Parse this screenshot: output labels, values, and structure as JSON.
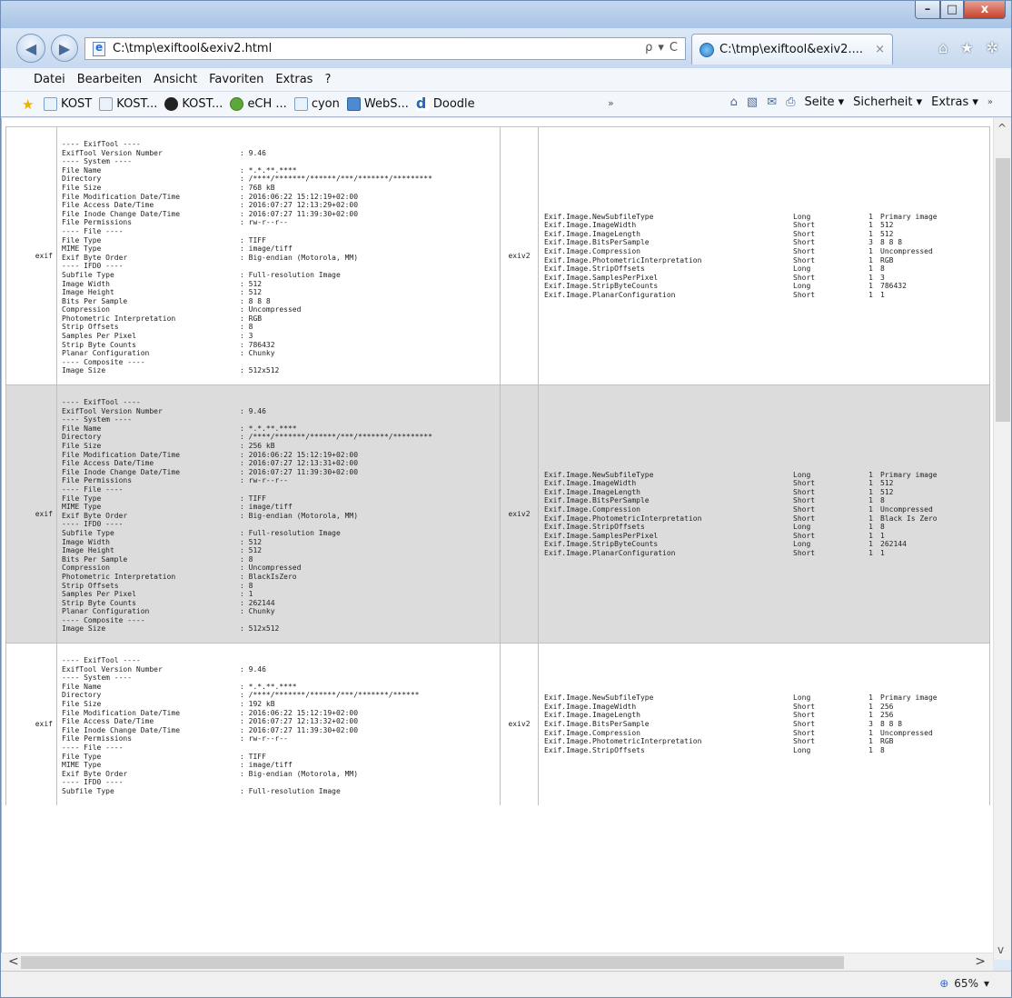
{
  "browser": {
    "address": "C:\\tmp\\exiftool&exiv2.html",
    "tab_title": "C:\\tmp\\exiftool&exiv2....",
    "tab_close": "×",
    "back_icon": "◀",
    "forward_icon": "▶",
    "search_icon": "ρ",
    "address_arrow": "▾",
    "refresh_icon": "C",
    "home_icon": "⌂",
    "favorites_icon": "★",
    "settings_icon": "✲",
    "window_minimize": "–",
    "window_maximize": "□",
    "window_close": "x"
  },
  "menu": [
    "Datei",
    "Bearbeiten",
    "Ansicht",
    "Favoriten",
    "Extras",
    "?"
  ],
  "favorites": [
    {
      "label": "KOST",
      "icon": "page-icon"
    },
    {
      "label": "KOST...",
      "icon": "page-icon"
    },
    {
      "label": "KOST...",
      "icon": "github-icon"
    },
    {
      "label": "eCH ...",
      "icon": "ech-icon"
    },
    {
      "label": "cyon",
      "icon": "page-icon"
    },
    {
      "label": "WebS...",
      "icon": "web-slice-icon"
    },
    {
      "label": "Doodle",
      "icon": "doodle-icon"
    }
  ],
  "favbar_more": "»",
  "commands": {
    "home_icon": "⌂",
    "feeds_icon": "▧",
    "mail_icon": "✉",
    "print_icon": "⎙",
    "page": "Seite ▾",
    "safety": "Sicherheit ▾",
    "tools": "Extras ▾",
    "more": "»"
  },
  "zoom": "65%",
  "zoom_icon": "⊕",
  "zoom_arrow": "▾",
  "scroll": {
    "up": "^",
    "down": "v",
    "left": "<",
    "right": ">"
  },
  "rows": [
    {
      "label1": "exif",
      "label2": "exiv2",
      "exif_lines": [
        [
          "---- ExifTool ----",
          ""
        ],
        [
          "ExifTool Version Number",
          ": 9.46"
        ],
        [
          "---- System ----",
          ""
        ],
        [
          "File Name",
          ": *.*.**.****"
        ],
        [
          "Directory",
          ": /****/*******/******/***/*******/*********"
        ],
        [
          "File Size",
          ": 768 kB"
        ],
        [
          "File Modification Date/Time",
          ": 2016:06:22 15:12:19+02:00"
        ],
        [
          "File Access Date/Time",
          ": 2016:07:27 12:13:29+02:00"
        ],
        [
          "File Inode Change Date/Time",
          ": 2016:07:27 11:39:30+02:00"
        ],
        [
          "File Permissions",
          ": rw-r--r--"
        ],
        [
          "---- File ----",
          ""
        ],
        [
          "File Type",
          ": TIFF"
        ],
        [
          "MIME Type",
          ": image/tiff"
        ],
        [
          "Exif Byte Order",
          ": Big-endian (Motorola, MM)"
        ],
        [
          "---- IFD0 ----",
          ""
        ],
        [
          "Subfile Type",
          ": Full-resolution Image"
        ],
        [
          "Image Width",
          ": 512"
        ],
        [
          "Image Height",
          ": 512"
        ],
        [
          "Bits Per Sample",
          ": 8 8 8"
        ],
        [
          "Compression",
          ": Uncompressed"
        ],
        [
          "Photometric Interpretation",
          ": RGB"
        ],
        [
          "Strip Offsets",
          ": 8"
        ],
        [
          "Samples Per Pixel",
          ": 3"
        ],
        [
          "Strip Byte Counts",
          ": 786432"
        ],
        [
          "Planar Configuration",
          ": Chunky"
        ],
        [
          "---- Composite ----",
          ""
        ],
        [
          "Image Size",
          ": 512x512"
        ]
      ],
      "exiv2_lines": [
        [
          "Exif.Image.NewSubfileType",
          "Long",
          "1",
          "Primary image"
        ],
        [
          "Exif.Image.ImageWidth",
          "Short",
          "1",
          "512"
        ],
        [
          "Exif.Image.ImageLength",
          "Short",
          "1",
          "512"
        ],
        [
          "Exif.Image.BitsPerSample",
          "Short",
          "3",
          "8 8 8"
        ],
        [
          "Exif.Image.Compression",
          "Short",
          "1",
          "Uncompressed"
        ],
        [
          "Exif.Image.PhotometricInterpretation",
          "Short",
          "1",
          "RGB"
        ],
        [
          "Exif.Image.StripOffsets",
          "Long",
          "1",
          "8"
        ],
        [
          "Exif.Image.SamplesPerPixel",
          "Short",
          "1",
          "3"
        ],
        [
          "Exif.Image.StripByteCounts",
          "Long",
          "1",
          "786432"
        ],
        [
          "Exif.Image.PlanarConfiguration",
          "Short",
          "1",
          "1"
        ]
      ]
    },
    {
      "label1": "exif",
      "label2": "exiv2",
      "exif_lines": [
        [
          "---- ExifTool ----",
          ""
        ],
        [
          "ExifTool Version Number",
          ": 9.46"
        ],
        [
          "---- System ----",
          ""
        ],
        [
          "File Name",
          ": *.*.**.****"
        ],
        [
          "Directory",
          ": /****/*******/******/***/*******/*********"
        ],
        [
          "File Size",
          ": 256 kB"
        ],
        [
          "File Modification Date/Time",
          ": 2016:06:22 15:12:19+02:00"
        ],
        [
          "File Access Date/Time",
          ": 2016:07:27 12:13:31+02:00"
        ],
        [
          "File Inode Change Date/Time",
          ": 2016:07:27 11:39:30+02:00"
        ],
        [
          "File Permissions",
          ": rw-r--r--"
        ],
        [
          "---- File ----",
          ""
        ],
        [
          "File Type",
          ": TIFF"
        ],
        [
          "MIME Type",
          ": image/tiff"
        ],
        [
          "Exif Byte Order",
          ": Big-endian (Motorola, MM)"
        ],
        [
          "---- IFD0 ----",
          ""
        ],
        [
          "Subfile Type",
          ": Full-resolution Image"
        ],
        [
          "Image Width",
          ": 512"
        ],
        [
          "Image Height",
          ": 512"
        ],
        [
          "Bits Per Sample",
          ": 8"
        ],
        [
          "Compression",
          ": Uncompressed"
        ],
        [
          "Photometric Interpretation",
          ": BlackIsZero"
        ],
        [
          "Strip Offsets",
          ": 8"
        ],
        [
          "Samples Per Pixel",
          ": 1"
        ],
        [
          "Strip Byte Counts",
          ": 262144"
        ],
        [
          "Planar Configuration",
          ": Chunky"
        ],
        [
          "---- Composite ----",
          ""
        ],
        [
          "Image Size",
          ": 512x512"
        ]
      ],
      "exiv2_lines": [
        [
          "Exif.Image.NewSubfileType",
          "Long",
          "1",
          "Primary image"
        ],
        [
          "Exif.Image.ImageWidth",
          "Short",
          "1",
          "512"
        ],
        [
          "Exif.Image.ImageLength",
          "Short",
          "1",
          "512"
        ],
        [
          "Exif.Image.BitsPerSample",
          "Short",
          "1",
          "8"
        ],
        [
          "Exif.Image.Compression",
          "Short",
          "1",
          "Uncompressed"
        ],
        [
          "Exif.Image.PhotometricInterpretation",
          "Short",
          "1",
          "Black Is Zero"
        ],
        [
          "Exif.Image.StripOffsets",
          "Long",
          "1",
          "8"
        ],
        [
          "Exif.Image.SamplesPerPixel",
          "Short",
          "1",
          "1"
        ],
        [
          "Exif.Image.StripByteCounts",
          "Long",
          "1",
          "262144"
        ],
        [
          "Exif.Image.PlanarConfiguration",
          "Short",
          "1",
          "1"
        ]
      ]
    },
    {
      "label1": "exif",
      "label2": "exiv2",
      "exif_lines": [
        [
          "---- ExifTool ----",
          ""
        ],
        [
          "ExifTool Version Number",
          ": 9.46"
        ],
        [
          "---- System ----",
          ""
        ],
        [
          "File Name",
          ": *.*.**.****"
        ],
        [
          "Directory",
          ": /****/*******/******/***/*******/******"
        ],
        [
          "File Size",
          ": 192 kB"
        ],
        [
          "File Modification Date/Time",
          ": 2016:06:22 15:12:19+02:00"
        ],
        [
          "File Access Date/Time",
          ": 2016:07:27 12:13:32+02:00"
        ],
        [
          "File Inode Change Date/Time",
          ": 2016:07:27 11:39:30+02:00"
        ],
        [
          "File Permissions",
          ": rw-r--r--"
        ],
        [
          "---- File ----",
          ""
        ],
        [
          "File Type",
          ": TIFF"
        ],
        [
          "MIME Type",
          ": image/tiff"
        ],
        [
          "Exif Byte Order",
          ": Big-endian (Motorola, MM)"
        ],
        [
          "---- IFD0 ----",
          ""
        ],
        [
          "Subfile Type",
          ": Full-resolution Image"
        ]
      ],
      "exiv2_lines": [
        [
          "Exif.Image.NewSubfileType",
          "Long",
          "1",
          "Primary image"
        ],
        [
          "Exif.Image.ImageWidth",
          "Short",
          "1",
          "256"
        ],
        [
          "Exif.Image.ImageLength",
          "Short",
          "1",
          "256"
        ],
        [
          "Exif.Image.BitsPerSample",
          "Short",
          "3",
          "8 8 8"
        ],
        [
          "Exif.Image.Compression",
          "Short",
          "1",
          "Uncompressed"
        ],
        [
          "Exif.Image.PhotometricInterpretation",
          "Short",
          "1",
          "RGB"
        ],
        [
          "Exif.Image.StripOffsets",
          "Long",
          "1",
          "8"
        ]
      ]
    }
  ]
}
